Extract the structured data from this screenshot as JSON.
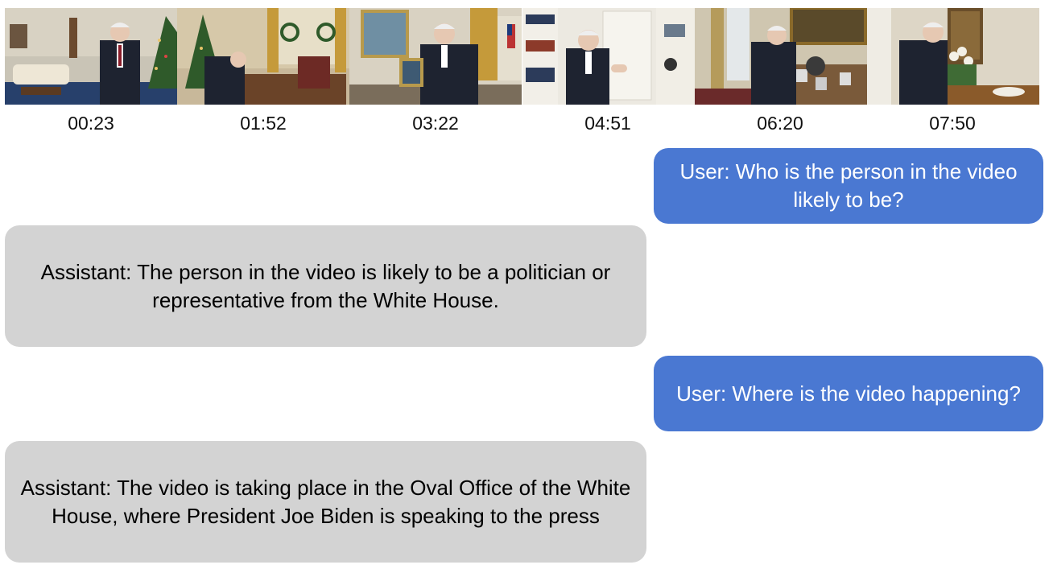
{
  "frames": [
    {
      "timestamp": "00:23"
    },
    {
      "timestamp": "01:52"
    },
    {
      "timestamp": "03:22"
    },
    {
      "timestamp": "04:51"
    },
    {
      "timestamp": "06:20"
    },
    {
      "timestamp": "07:50"
    }
  ],
  "conversation": [
    {
      "role": "user",
      "text": "User: Who is the person in the video likely to be?"
    },
    {
      "role": "assistant",
      "text": "Assistant: The person in the video is likely to be a politician or representative from the White House."
    },
    {
      "role": "user",
      "text": "User: Where is the video happening?"
    },
    {
      "role": "assistant",
      "text": "Assistant: The video is taking place in the Oval Office of the White House, where President Joe Biden is speaking to the press"
    }
  ],
  "colors": {
    "user_bubble": "#4a78d2",
    "assistant_bubble": "#d3d3d3"
  }
}
